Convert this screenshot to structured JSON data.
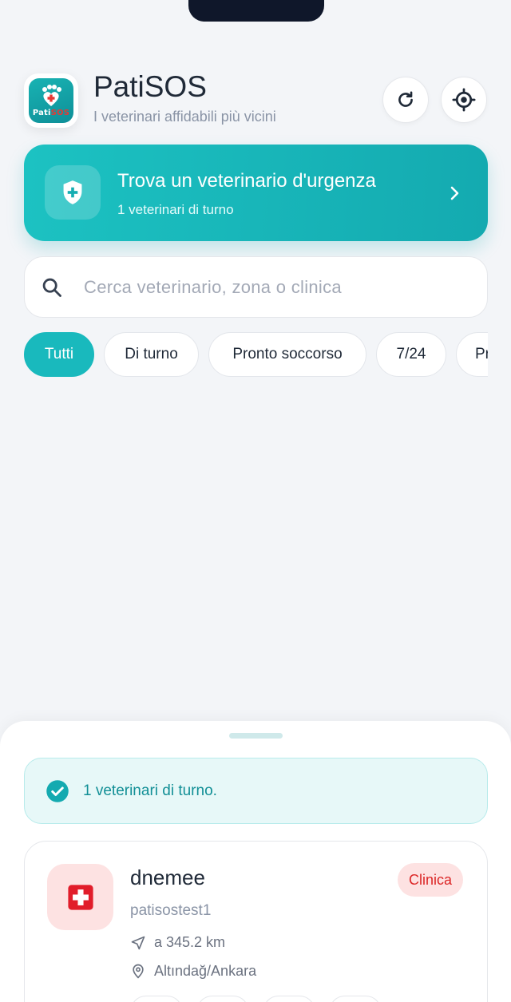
{
  "header": {
    "title": "PatiSOS",
    "subtitle": "I veterinari affidabili più vicini",
    "logo_text_a": "Pati",
    "logo_text_b": "SOS"
  },
  "emergency": {
    "title": "Trova un veterinario d'urgenza",
    "subtitle": "1 veterinari di turno"
  },
  "search": {
    "placeholder": "Cerca veterinario, zona o clinica",
    "value": ""
  },
  "filters": [
    {
      "label": "Tutti",
      "active": true
    },
    {
      "label": "Di turno",
      "active": false
    },
    {
      "label": "Pronto soccorso",
      "active": false
    },
    {
      "label": "7/24",
      "active": false
    },
    {
      "label": "Pr",
      "active": false
    }
  ],
  "sheet": {
    "status_text": "1 veterinari di turno."
  },
  "vet": {
    "name": "dnemee",
    "subtitle": "patisostest1",
    "badge": "Clinica",
    "distance": "a 345.2 km",
    "location": "Altındağ/Ankara"
  },
  "colors": {
    "accent": "#19b9bd",
    "danger": "#dc2626",
    "background": "#f3f5f8"
  },
  "icons": [
    "refresh-icon",
    "locate-icon",
    "shield-icon",
    "chevron-right-icon",
    "search-icon",
    "check-circle-icon",
    "medical-cross-icon",
    "navigation-icon",
    "map-pin-icon"
  ]
}
